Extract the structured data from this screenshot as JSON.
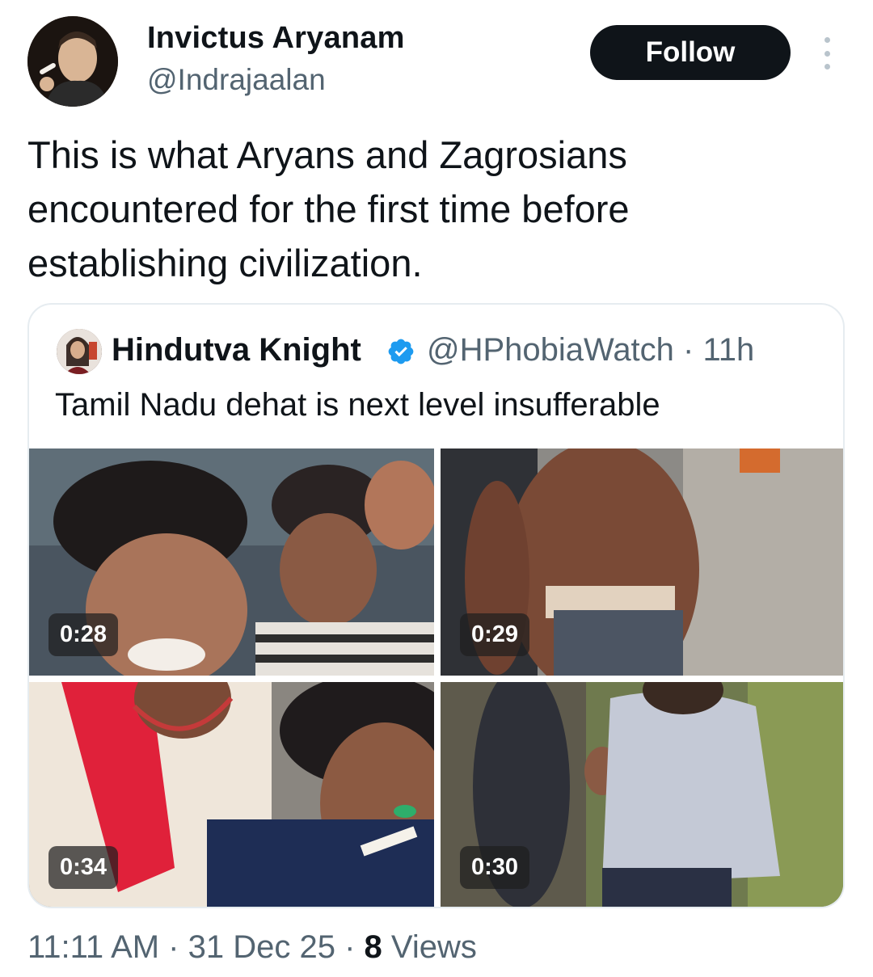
{
  "author": {
    "display_name": "Invictus Aryanam",
    "handle": "@Indrajaalan",
    "follow_label": "Follow"
  },
  "tweet": {
    "text": "This is what Aryans and Zagrosians encountered for the first time before establishing civilization."
  },
  "quoted": {
    "display_name": "Hindutva Knight",
    "handle_time": "@HPhobiaWatch · 11h",
    "text": "Tamil Nadu dehat is next level insufferable",
    "videos": [
      {
        "duration": "0:28"
      },
      {
        "duration": "0:29"
      },
      {
        "duration": "0:34"
      },
      {
        "duration": "0:30"
      }
    ]
  },
  "meta": {
    "time_date": "11:11 AM · 31 Dec 25 · ",
    "views_count": "8",
    "views_label": " Views"
  },
  "colors": {
    "text_primary": "#0f1419",
    "text_secondary": "#536471",
    "verified": "#1d9bf0",
    "follow_bg": "#0f1419"
  }
}
